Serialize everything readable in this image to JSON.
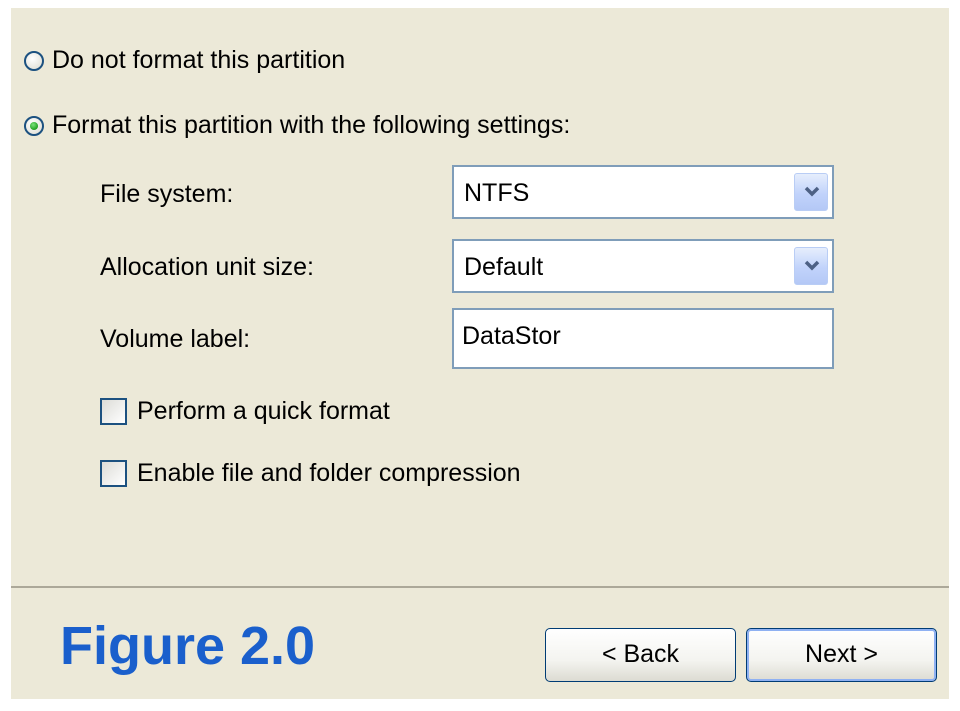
{
  "options": {
    "no_format_label": "Do not format this partition",
    "format_label": "Format this partition with the following settings:",
    "selected": "format"
  },
  "settings": {
    "file_system_label": "File system:",
    "file_system_value": "NTFS",
    "allocation_label": "Allocation unit size:",
    "allocation_value": "Default",
    "volume_label_label": "Volume label:",
    "volume_label_value": "DataStor"
  },
  "checkboxes": {
    "quick_format_label": "Perform a quick format",
    "quick_format_checked": false,
    "compression_label": "Enable file and folder compression",
    "compression_checked": false
  },
  "footer": {
    "figure_title": "Figure 2.0",
    "back_label": "< Back",
    "next_label": "Next >"
  },
  "icons": {
    "dropdown_arrow": "chevron-down-icon"
  },
  "colors": {
    "panel_background": "#ece9d8",
    "figure_title": "#1a5fcc",
    "radio_selected_dot": "#21a121",
    "field_border": "#7f9db9"
  }
}
